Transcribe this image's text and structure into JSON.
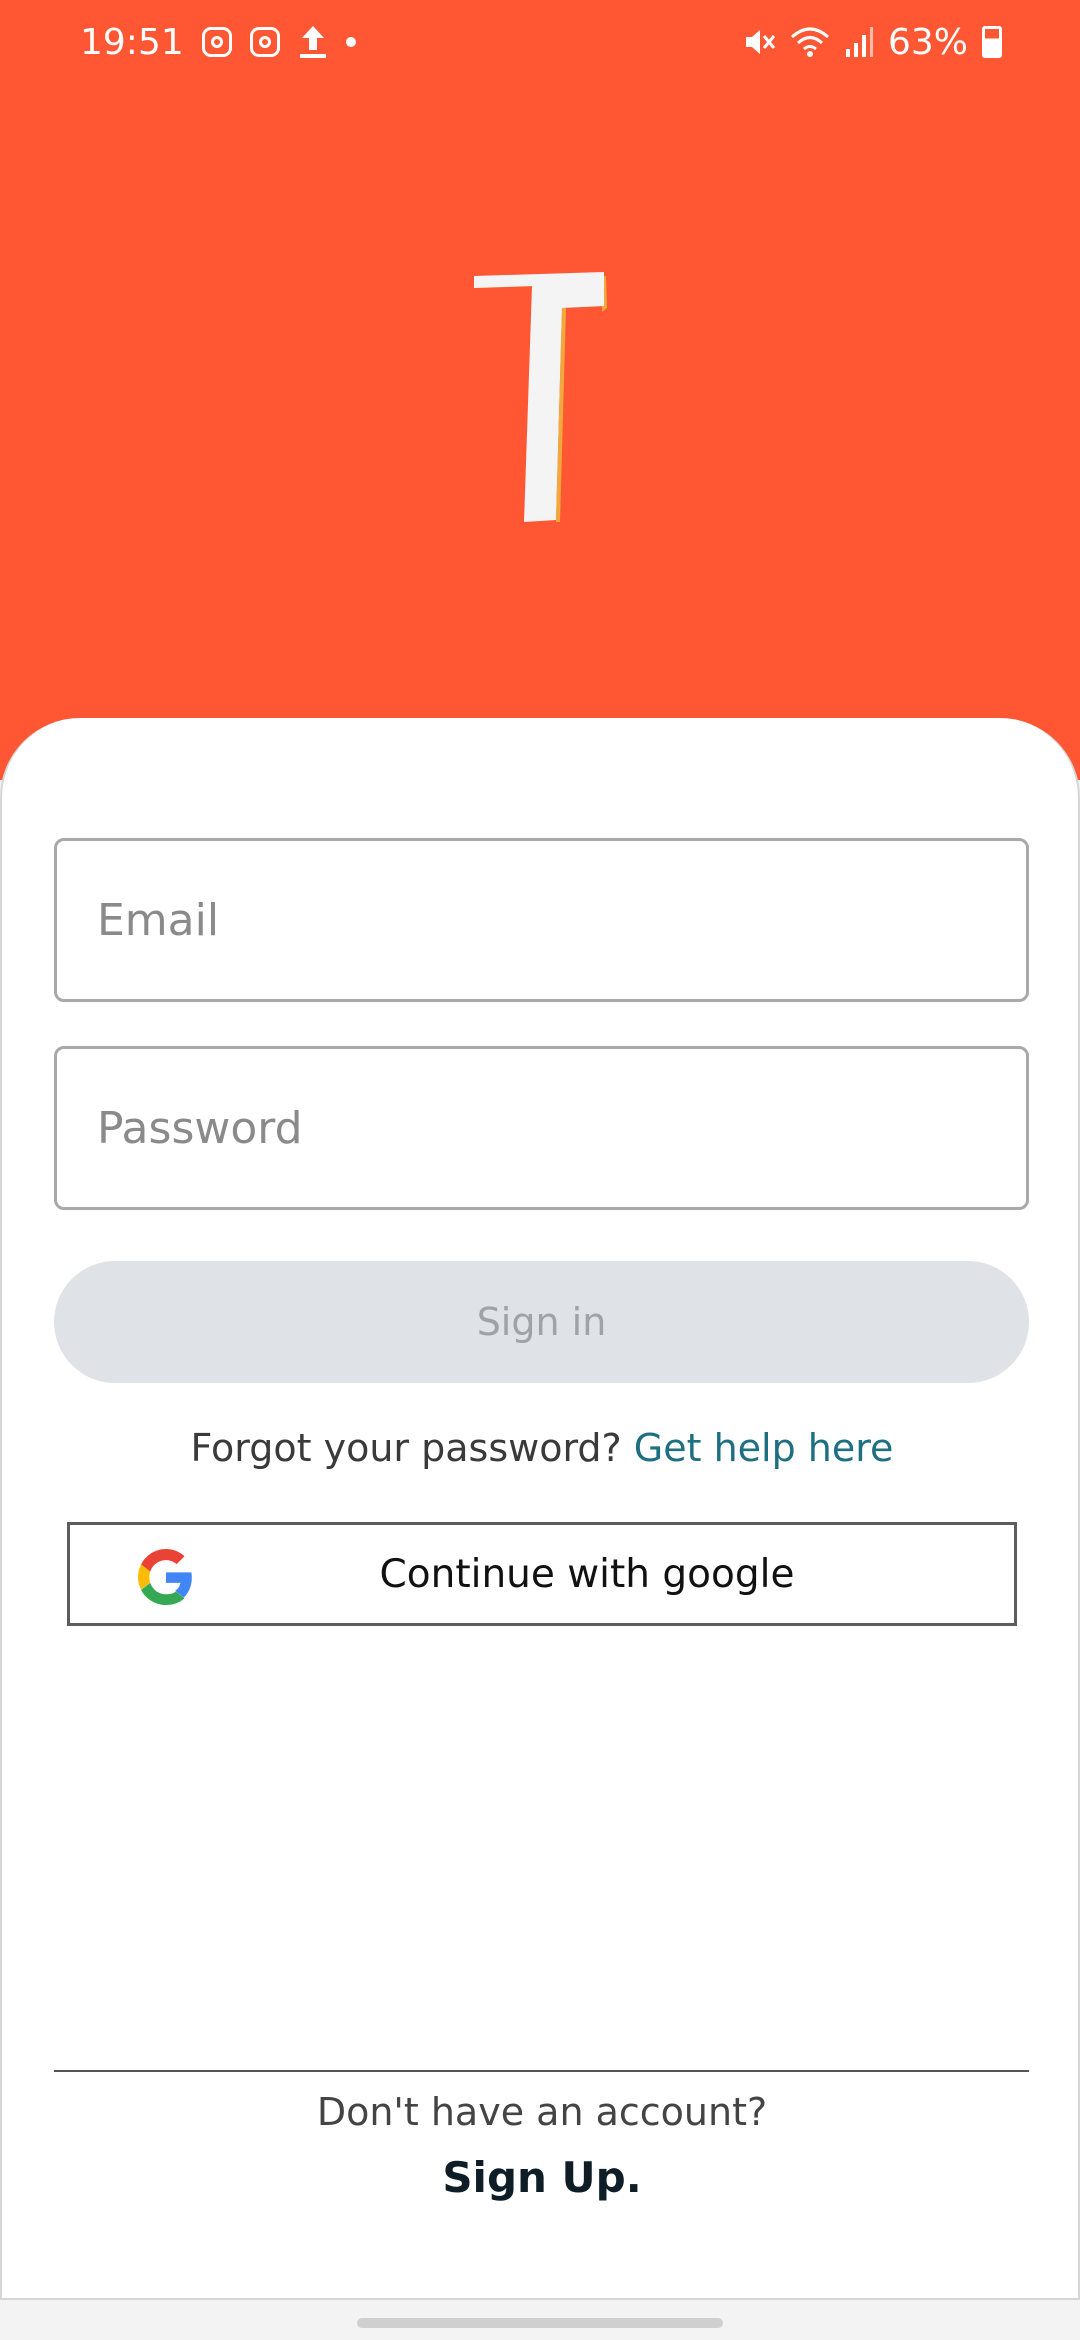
{
  "status_bar": {
    "time": "19:51",
    "battery": "63%"
  },
  "login": {
    "email_placeholder": "Email",
    "password_placeholder": "Password",
    "signin_label": "Sign in",
    "forgot_text": "Forgot your password? ",
    "forgot_link": "Get help here",
    "google_label": "Continue with google",
    "no_account_text": "Don't have an account?",
    "signup_label": "Sign Up."
  },
  "colors": {
    "brand": "#ff5733",
    "link": "#1f6f82",
    "button_disabled": "#dfe3e7"
  },
  "icons": [
    "instagram-icon",
    "instagram-icon",
    "upload-icon",
    "mute-icon",
    "wifi-icon",
    "signal-icon",
    "battery-icon",
    "google-icon"
  ]
}
